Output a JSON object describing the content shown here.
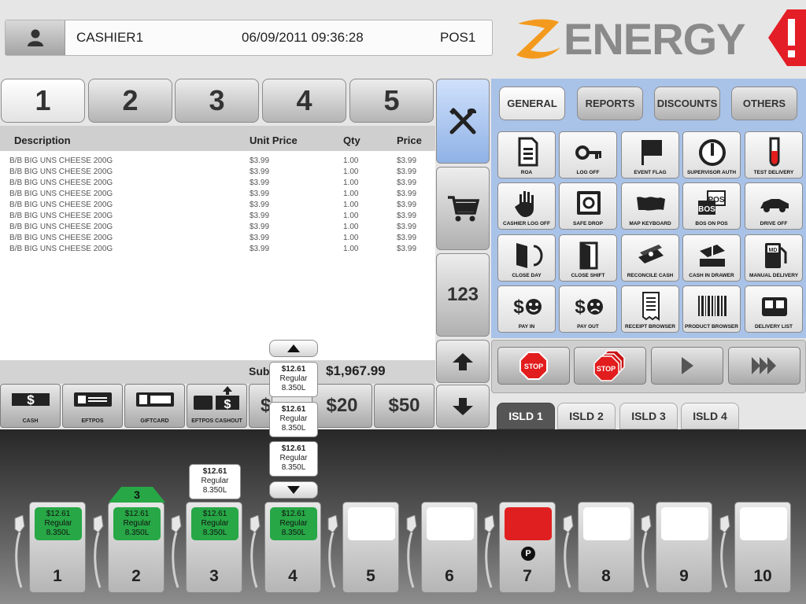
{
  "header": {
    "cashier": "CASHIER1",
    "datetime": "06/09/2011 09:36:28",
    "pos": "POS1"
  },
  "brand": {
    "name": "ENERGY",
    "alert": "!"
  },
  "sale_tabs": [
    "1",
    "2",
    "3",
    "4",
    "5"
  ],
  "receipt": {
    "columns": [
      "Description",
      "Unit Price",
      "Qty",
      "Price"
    ],
    "rows": [
      {
        "desc": "B/B BIG UNS CHEESE 200G",
        "unit": "$3.99",
        "qty": "1.00",
        "price": "$3.99"
      },
      {
        "desc": "B/B BIG UNS CHEESE 200G",
        "unit": "$3.99",
        "qty": "1.00",
        "price": "$3.99"
      },
      {
        "desc": "B/B BIG UNS CHEESE 200G",
        "unit": "$3.99",
        "qty": "1.00",
        "price": "$3.99"
      },
      {
        "desc": "B/B BIG UNS CHEESE 200G",
        "unit": "$3.99",
        "qty": "1.00",
        "price": "$3.99"
      },
      {
        "desc": "B/B BIG UNS CHEESE 200G",
        "unit": "$3.99",
        "qty": "1.00",
        "price": "$3.99"
      },
      {
        "desc": "B/B BIG UNS CHEESE 200G",
        "unit": "$3.99",
        "qty": "1.00",
        "price": "$3.99"
      },
      {
        "desc": "B/B BIG UNS CHEESE 200G",
        "unit": "$3.99",
        "qty": "1.00",
        "price": "$3.99"
      },
      {
        "desc": "B/B BIG UNS CHEESE 200G",
        "unit": "$3.99",
        "qty": "1.00",
        "price": "$3.99"
      },
      {
        "desc": "B/B BIG UNS CHEESE 200G",
        "unit": "$3.99",
        "qty": "1.00",
        "price": "$3.99"
      }
    ],
    "subtotal_label": "Sub",
    "subtotal_value": "$1,967.99"
  },
  "payment": {
    "cash": "CASH",
    "eftpos": "EFTPOS",
    "giftcard": "GIFTCARD",
    "eftpos_cashout": "EFTPOS CASHOUT",
    "cash_icon_glyph": "$",
    "cash_20": "$20",
    "cash_50": "$50",
    "partial_note": "$"
  },
  "sidebar": {
    "numpad": "123"
  },
  "categories": [
    "GENERAL",
    "REPORTS",
    "DISCOUNTS",
    "OTHERS"
  ],
  "functions": [
    {
      "label": "ROA",
      "icon": "document-icon"
    },
    {
      "label": "LOG OFF",
      "icon": "key-icon"
    },
    {
      "label": "EVENT FLAG",
      "icon": "flag-icon"
    },
    {
      "label": "SUPERVISOR AUTH",
      "icon": "power-icon"
    },
    {
      "label": "TEST DELIVERY",
      "icon": "test-tube-icon"
    },
    {
      "label": "CASHIER LOG OFF",
      "icon": "hand-icon"
    },
    {
      "label": "SAFE DROP",
      "icon": "safe-icon"
    },
    {
      "label": "MAP KEYBOARD",
      "icon": "keyboard-map-icon"
    },
    {
      "label": "BOS ON POS",
      "icon": "bos-pos-icon"
    },
    {
      "label": "DRIVE OFF",
      "icon": "car-icon"
    },
    {
      "label": "CLOSE DAY",
      "icon": "close-day-icon"
    },
    {
      "label": "CLOSE SHIFT",
      "icon": "door-icon"
    },
    {
      "label": "RECONCILE CASH",
      "icon": "money-icon"
    },
    {
      "label": "CASH IN DRAWER",
      "icon": "cash-drawer-icon"
    },
    {
      "label": "MANUAL DELIVERY",
      "icon": "fuel-pump-icon"
    },
    {
      "label": "PAY IN",
      "icon": "pay-in-icon"
    },
    {
      "label": "PAY OUT",
      "icon": "pay-out-icon"
    },
    {
      "label": "RECEIPT BROWSER",
      "icon": "receipt-icon"
    },
    {
      "label": "PRODUCT BROWSER",
      "icon": "barcode-icon"
    },
    {
      "label": "DELIVERY LIST",
      "icon": "delivery-list-icon"
    }
  ],
  "controls": {
    "stop": "STOP",
    "stop_all": "STOP"
  },
  "islands": [
    "ISLD 1",
    "ISLD 2",
    "ISLD 3",
    "ISLD 4"
  ],
  "pump_popup": [
    {
      "amount": "$12.61",
      "grade": "Regular",
      "volume": "8.350L"
    },
    {
      "amount": "$12.61",
      "grade": "Regular",
      "volume": "8.350L"
    },
    {
      "amount": "$12.61",
      "grade": "Regular",
      "volume": "8.350L"
    }
  ],
  "pump3_stack": {
    "amount": "$12.61",
    "grade": "Regular",
    "volume": "8.350L"
  },
  "pump2_badge": "3",
  "pumps": [
    {
      "num": "1",
      "state": "green",
      "amount": "$12.61",
      "grade": "Regular",
      "volume": "8.350L"
    },
    {
      "num": "2",
      "state": "green",
      "amount": "$12.61",
      "grade": "Regular",
      "volume": "8.350L"
    },
    {
      "num": "3",
      "state": "green",
      "amount": "$12.61",
      "grade": "Regular",
      "volume": "8.350L"
    },
    {
      "num": "4",
      "state": "green",
      "amount": "$12.61",
      "grade": "Regular",
      "volume": "8.350L"
    },
    {
      "num": "5",
      "state": "idle"
    },
    {
      "num": "6",
      "state": "idle"
    },
    {
      "num": "7",
      "state": "red",
      "badge": "P"
    },
    {
      "num": "8",
      "state": "idle"
    },
    {
      "num": "9",
      "state": "idle"
    },
    {
      "num": "10",
      "state": "idle"
    }
  ],
  "colors": {
    "green": "#27a746",
    "red": "#e02020",
    "panel_blue": "#a9c2e8",
    "brand_orange": "#f39a1e"
  }
}
